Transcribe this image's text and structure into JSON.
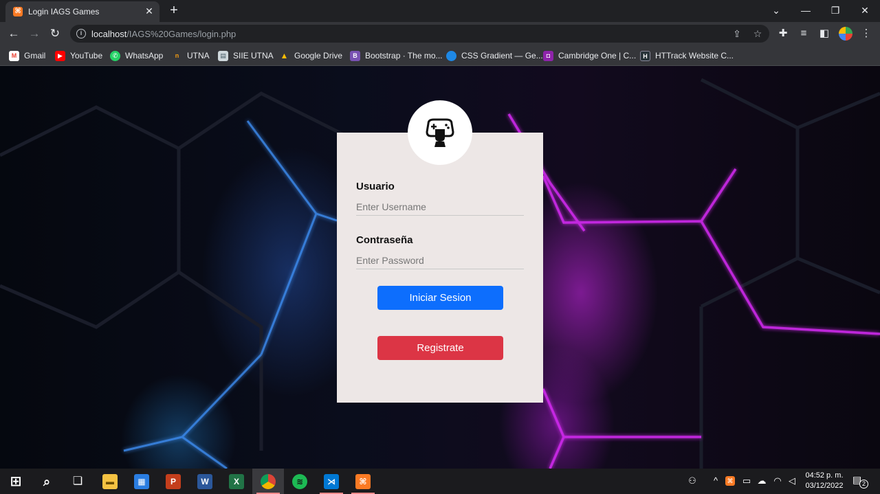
{
  "browser": {
    "tab_title": "Login IAGS Games",
    "tab_close": "✕",
    "new_tab": "+",
    "url_host": "localhost",
    "url_path": "/IAGS%20Games/login.php",
    "window_controls": {
      "minimize": "—",
      "restore": "❐",
      "close": "✕",
      "tab_search": "⌄"
    }
  },
  "bookmarks": [
    {
      "label": "Gmail",
      "icon": "gmail-icon",
      "color": "#ea4335",
      "glyph": "M"
    },
    {
      "label": "YouTube",
      "icon": "youtube-icon",
      "color": "#ff0000",
      "glyph": "▶"
    },
    {
      "label": "WhatsApp",
      "icon": "whatsapp-icon",
      "color": "#25d366",
      "glyph": "✆"
    },
    {
      "label": "UTNA",
      "icon": "utna-icon",
      "color": "#f39c12",
      "glyph": "n"
    },
    {
      "label": "SIIE UTNA",
      "icon": "siie-icon",
      "color": "#cfd8dc",
      "glyph": "▤"
    },
    {
      "label": "Google Drive",
      "icon": "google-drive-icon",
      "color": "#fbbc05",
      "glyph": "▲"
    },
    {
      "label": "Bootstrap · The mo...",
      "icon": "bootstrap-icon",
      "color": "#7952b3",
      "glyph": "B"
    },
    {
      "label": "CSS Gradient — Ge...",
      "icon": "css-gradient-icon",
      "color": "#1e88e5",
      "glyph": "●"
    },
    {
      "label": "Cambridge One | C...",
      "icon": "cambridge-icon",
      "color": "#8e24aa",
      "glyph": "◘"
    },
    {
      "label": "HTTrack Website C...",
      "icon": "httrack-icon",
      "color": "#263238",
      "glyph": "H"
    }
  ],
  "login": {
    "username_label": "Usuario",
    "username_placeholder": "Enter Username",
    "password_label": "Contraseña",
    "password_placeholder": "Enter Password",
    "login_button": "Iniciar Sesion",
    "register_button": "Registrate"
  },
  "colors": {
    "primary": "#0d6efd",
    "danger": "#dc3545",
    "card": "#ede7e6",
    "neon_purple": "#d22cf0",
    "neon_blue": "#3c8cf0"
  },
  "taskbar": {
    "apps": [
      {
        "name": "start-icon",
        "glyph": "⊞",
        "color": "transparent"
      },
      {
        "name": "search-icon",
        "glyph": "⌕",
        "color": "transparent"
      },
      {
        "name": "task-view-icon",
        "glyph": "❏",
        "color": "transparent"
      },
      {
        "name": "file-explorer-icon",
        "glyph": "▬",
        "color": "#f5c242"
      },
      {
        "name": "microsoft-store-icon",
        "glyph": "▦",
        "color": "#2a7de1"
      },
      {
        "name": "powerpoint-icon",
        "glyph": "P",
        "color": "#c43e1c"
      },
      {
        "name": "word-icon",
        "glyph": "W",
        "color": "#2b579a"
      },
      {
        "name": "excel-icon",
        "glyph": "X",
        "color": "#217346"
      },
      {
        "name": "chrome-icon",
        "glyph": "◉",
        "color": "#db4437"
      },
      {
        "name": "spotify-icon",
        "glyph": "≋",
        "color": "#1db954"
      },
      {
        "name": "vscode-icon",
        "glyph": "⋊",
        "color": "#0078d4"
      },
      {
        "name": "xampp-icon",
        "glyph": "⌘",
        "color": "#fb7a24"
      }
    ],
    "time": "04:52 p. m.",
    "date": "03/12/2022",
    "notification_count": "2"
  }
}
